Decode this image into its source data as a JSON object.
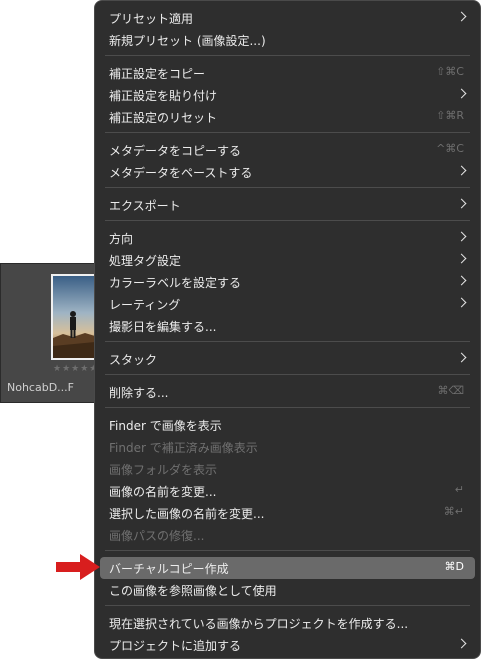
{
  "thumbnail": {
    "stars": "★★★★★",
    "filename": "NohcabD...F"
  },
  "menu": {
    "items": [
      {
        "label": "プリセット適用",
        "shortcut": "",
        "submenu": true,
        "disabled": false
      },
      {
        "label": "新規プリセット (画像設定...)",
        "shortcut": "",
        "submenu": false,
        "disabled": false
      },
      {
        "label": "補正設定をコピー",
        "shortcut": "⇧⌘C",
        "submenu": false,
        "disabled": false
      },
      {
        "label": "補正設定を貼り付け",
        "shortcut": "",
        "submenu": true,
        "disabled": false
      },
      {
        "label": "補正設定のリセット",
        "shortcut": "⇧⌘R",
        "submenu": false,
        "disabled": false
      },
      {
        "label": "メタデータをコピーする",
        "shortcut": "^⌘C",
        "submenu": false,
        "disabled": false
      },
      {
        "label": "メタデータをペーストする",
        "shortcut": "",
        "submenu": true,
        "disabled": false
      },
      {
        "label": "エクスポート",
        "shortcut": "",
        "submenu": true,
        "disabled": false
      },
      {
        "label": "方向",
        "shortcut": "",
        "submenu": true,
        "disabled": false
      },
      {
        "label": "処理タグ設定",
        "shortcut": "",
        "submenu": true,
        "disabled": false
      },
      {
        "label": "カラーラベルを設定する",
        "shortcut": "",
        "submenu": true,
        "disabled": false
      },
      {
        "label": "レーティング",
        "shortcut": "",
        "submenu": true,
        "disabled": false
      },
      {
        "label": "撮影日を編集する...",
        "shortcut": "",
        "submenu": false,
        "disabled": false
      },
      {
        "label": "スタック",
        "shortcut": "",
        "submenu": true,
        "disabled": false
      },
      {
        "label": "削除する...",
        "shortcut": "⌘⌫",
        "submenu": false,
        "disabled": false
      },
      {
        "label": "Finder で画像を表示",
        "shortcut": "",
        "submenu": false,
        "disabled": false
      },
      {
        "label": "Finder で補正済み画像表示",
        "shortcut": "",
        "submenu": false,
        "disabled": true
      },
      {
        "label": "画像フォルダを表示",
        "shortcut": "",
        "submenu": false,
        "disabled": true
      },
      {
        "label": "画像の名前を変更...",
        "shortcut": "↵",
        "submenu": false,
        "disabled": false
      },
      {
        "label": "選択した画像の名前を変更...",
        "shortcut": "⌘↵",
        "submenu": false,
        "disabled": false
      },
      {
        "label": "画像パスの修復...",
        "shortcut": "",
        "submenu": false,
        "disabled": true
      },
      {
        "label": "バーチャルコピー作成",
        "shortcut": "⌘D",
        "submenu": false,
        "disabled": false,
        "highlighted": true
      },
      {
        "label": "この画像を参照画像として使用",
        "shortcut": "",
        "submenu": false,
        "disabled": false
      },
      {
        "label": "現在選択されている画像からプロジェクトを作成する...",
        "shortcut": "",
        "submenu": false,
        "disabled": false
      },
      {
        "label": "プロジェクトに追加する",
        "shortcut": "",
        "submenu": true,
        "disabled": false
      }
    ]
  },
  "colors": {
    "menu_bg": "#2e2e2e",
    "highlight": "#6a6a6a",
    "arrow": "#d81e1e"
  }
}
